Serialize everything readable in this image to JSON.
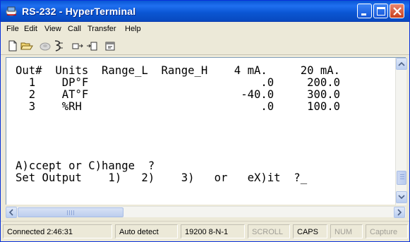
{
  "window": {
    "title": "RS-232 - HyperTerminal"
  },
  "menu": [
    "File",
    "Edit",
    "View",
    "Call",
    "Transfer",
    "Help"
  ],
  "toolbar": {
    "buttons": [
      "new-icon",
      "open-icon",
      "disconnect-icon",
      "connect-icon",
      "send-icon",
      "receive-icon",
      "properties-icon"
    ]
  },
  "terminal": {
    "lines": [
      "Out#  Units  Range_L  Range_H    4 mA.     20 mA.",
      "  1    DP°F                          .0     200.0",
      "  2    AT°F                       -40.0     300.0",
      "  3    %RH                           .0     100.0",
      "",
      "A)ccept or C)hange  ?",
      "Set Output    1)   2)    3)   or   eX)it  ?_"
    ]
  },
  "statusbar": {
    "connected": "Connected 2:46:31",
    "detect": "Auto detect",
    "settings": "19200 8-N-1",
    "scroll": "SCROLL",
    "caps": "CAPS",
    "num": "NUM",
    "capture": "Capture"
  },
  "colors": {
    "titlebar": "#0a57d4",
    "close_button": "#d2532f",
    "window_bg": "#ece9d8",
    "terminal_bg": "#ffffff"
  }
}
